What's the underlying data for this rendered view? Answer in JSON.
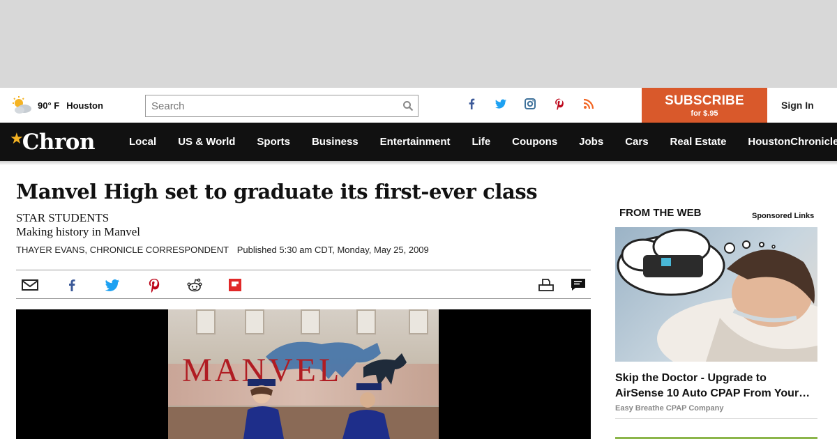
{
  "topbar": {
    "weather_temp": "90° F",
    "weather_city": "Houston",
    "search_placeholder": "Search",
    "subscribe_label": "SUBSCRIBE",
    "subscribe_price": "for $.95",
    "signin_label": "Sign In",
    "social_icons": [
      "facebook-icon",
      "twitter-icon",
      "instagram-icon",
      "pinterest-icon",
      "rss-icon"
    ]
  },
  "nav": {
    "logo_text": "Chron",
    "items": [
      "Local",
      "US & World",
      "Sports",
      "Business",
      "Entertainment",
      "Life",
      "Coupons",
      "Jobs",
      "Cars",
      "Real Estate",
      "HoustonChronicle.com"
    ]
  },
  "article": {
    "headline": "Manvel High set to graduate its first-ever class",
    "kicker": "STAR STUDENTS",
    "deck": "Making history in Manvel",
    "author": "THAYER EVANS, CHRONICLE CORRESPONDENT",
    "published": "Published 5:30 am CDT, Monday, May 25, 2009",
    "share_icons": [
      "email-icon",
      "facebook-icon",
      "twitter-icon",
      "pinterest-icon",
      "reddit-icon",
      "flipboard-icon",
      "print-icon",
      "comment-icon"
    ],
    "photo_banner_text": "MANVEL"
  },
  "sidebar": {
    "heading": "FROM THE WEB",
    "sponsored_label": "Sponsored Links",
    "ad_title": "Skip the Doctor - Upgrade to AirSense 10 Auto CPAP From Your…",
    "ad_source": "Easy Breathe CPAP Company"
  },
  "colors": {
    "subscribe_bg": "#d9592b",
    "nav_bg": "#111111",
    "logo_star": "#f5b323",
    "facebook": "#3b5998",
    "twitter": "#1da1f2",
    "pinterest": "#bd081c",
    "rss": "#f26522",
    "flipboard": "#e12828"
  }
}
